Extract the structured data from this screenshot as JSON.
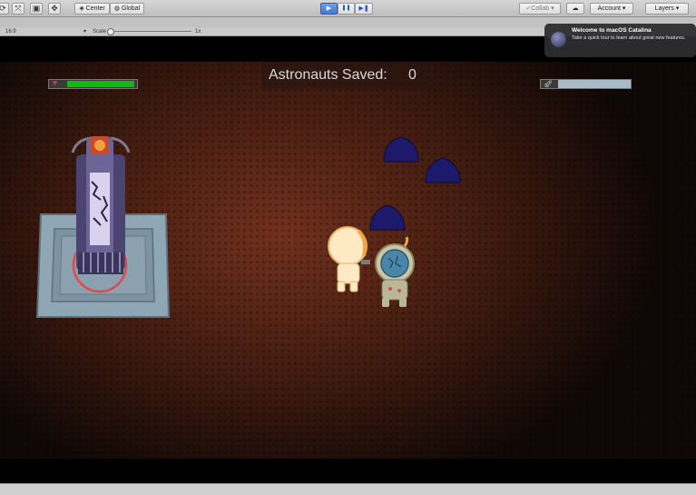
{
  "toolbar": {
    "tools": [
      {
        "name": "rotate-tool-icon",
        "glyph": "⟳"
      },
      {
        "name": "scale-tool-icon",
        "glyph": "⤧"
      },
      {
        "name": "rect-tool-icon",
        "glyph": "▣"
      },
      {
        "name": "transform-tool-icon",
        "glyph": "✥"
      }
    ],
    "pivot_label": "Center",
    "space_label": "Global",
    "play_icon": "▶",
    "pause_icon": "❚❚",
    "step_icon": "▶❚",
    "collab_label": "Collab",
    "account_label": "Account",
    "layers_label": "Layers",
    "cloud_icon": "☁"
  },
  "game_view": {
    "aspect": "16:9",
    "scale_label": "Scale",
    "scale_value": "1x"
  },
  "hud": {
    "score_label": "Astronauts Saved:",
    "score_value": "0",
    "health_fraction": 0.97,
    "health_color": "#0fbb0f",
    "rocket_fraction": 0.0
  },
  "notification": {
    "title": "Welcome to macOS Catalina",
    "body": "Take a quick tour to learn about great new features."
  },
  "colors": {
    "toolbar_bg": "#c6c6c6",
    "play_active": "#3f79d9",
    "slime": "#1d1a6b",
    "ground": "#6b2c18"
  }
}
